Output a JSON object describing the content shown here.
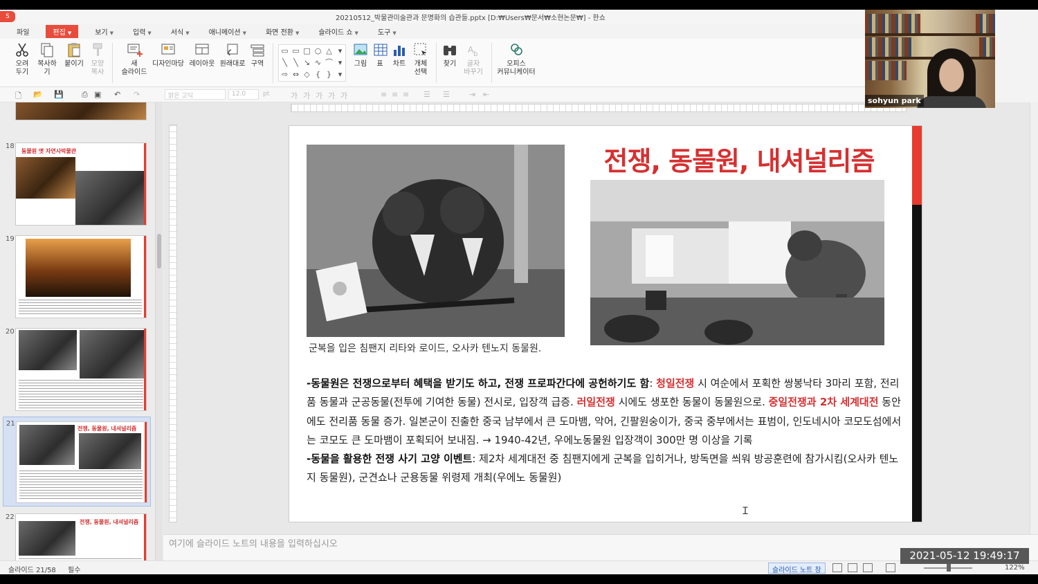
{
  "window": {
    "title": "20210512_박물관미술관과 문명화의 습관들.pptx [D:₩Users₩문서₩소현논문₩] - 한쇼",
    "logo": "S"
  },
  "menu": {
    "items": [
      {
        "label": "파일",
        "caret": false
      },
      {
        "label": "편집",
        "caret": true,
        "active": true
      },
      {
        "label": "보기",
        "caret": true
      },
      {
        "label": "입력",
        "caret": true
      },
      {
        "label": "서식",
        "caret": true
      },
      {
        "label": "애니메이션",
        "caret": true
      },
      {
        "label": "화면 전환",
        "caret": true
      },
      {
        "label": "슬라이드 쇼",
        "caret": true
      },
      {
        "label": "도구",
        "caret": true
      }
    ]
  },
  "ribbon": {
    "cut": "오려\n두기",
    "copy": "복사하기",
    "paste": "붙이기",
    "format_copy": "모양\n복사",
    "new_slide": "새\n슬라이드",
    "design_wizard": "디자인마당",
    "layout": "레이아웃",
    "revert": "원래대로",
    "section": "구역",
    "picture": "그림",
    "table": "표",
    "chart": "차트",
    "select_object": "개체\n선택",
    "find": "찾기",
    "text_replace": "글자\n바꾸기",
    "office_communicator": "오피스\n커뮤니케이터"
  },
  "format_toolbar": {
    "font": "맑은 고딕",
    "size": "12.0",
    "unit": "pt"
  },
  "slide_panel": {
    "thumbnails": [
      {
        "number": "18",
        "title": "동물원 앳 자연사박물관"
      },
      {
        "number": "19",
        "title": ""
      },
      {
        "number": "20",
        "title": ""
      },
      {
        "number": "21",
        "title": "전쟁, 동물원, 내셔널리즘",
        "selected": true
      },
      {
        "number": "22",
        "title": "전쟁, 동물원, 내셔널리즘"
      }
    ]
  },
  "slide": {
    "title": "전쟁, 동물원, 내셔널리즘",
    "caption": "군복을 입은 침팬지 리타와 로이드, 오사카 텐노지 동물원.",
    "para1_bold": "-동물원은 전쟁으로부터 혜택을 받기도 하고, 전쟁 프로파간다에 공헌하기도 함",
    "para1_a": ": ",
    "para1_hl1": "청일전쟁",
    "para1_b": " 시 여순에서 포획한 쌍봉낙타 3마리 포함, 전리품 동물과 군공동물(전투에 기여한 동물) 전시로, 입장객 급증. ",
    "para1_hl2": "러일전쟁",
    "para1_c": " 시에도 생포한 동물이 동물원으로. ",
    "para1_hl3": "중일전쟁과 2차 세계대전",
    "para1_d": " 동안에도 전리품 동물 증가. 일본군이 진출한 중국 남부에서 큰 도마뱀, 악어, 긴팔원숭이가, 중국 중부에서는 표범이, 인도네시아 코모도섬에서는 코모도 큰 도마뱀이 포획되어 보내짐. → 1940-42년, 우에노동물원 입장객이 300만 명 이상을 기록",
    "para2_bold": "-동물을 활용한 전쟁 사기 고양 이벤트",
    "para2_a": ": 제2차 세계대전 중 침팬지에게 군복을 입히거나, 방독면을 씌워 방공훈련에 참가시킴(오사카 텐노지 동물원), 군견쇼나 군용동물 위령제 개최(우에노 동물원)"
  },
  "notes": {
    "placeholder": "여기에 슬라이드 노트의 내용을 입력하십시오"
  },
  "status": {
    "slide_position": "슬라이드 21/58",
    "required": "필수",
    "notes_toggle": "슬라이드 노트 창",
    "zoom": "122%"
  },
  "webcam": {
    "name": "sohyun park"
  },
  "timestamp": "2021-05-12  19:49:17",
  "colors": {
    "accent": "#e74c3c",
    "slide_title": "#d63031",
    "highlight": "#d63031"
  }
}
